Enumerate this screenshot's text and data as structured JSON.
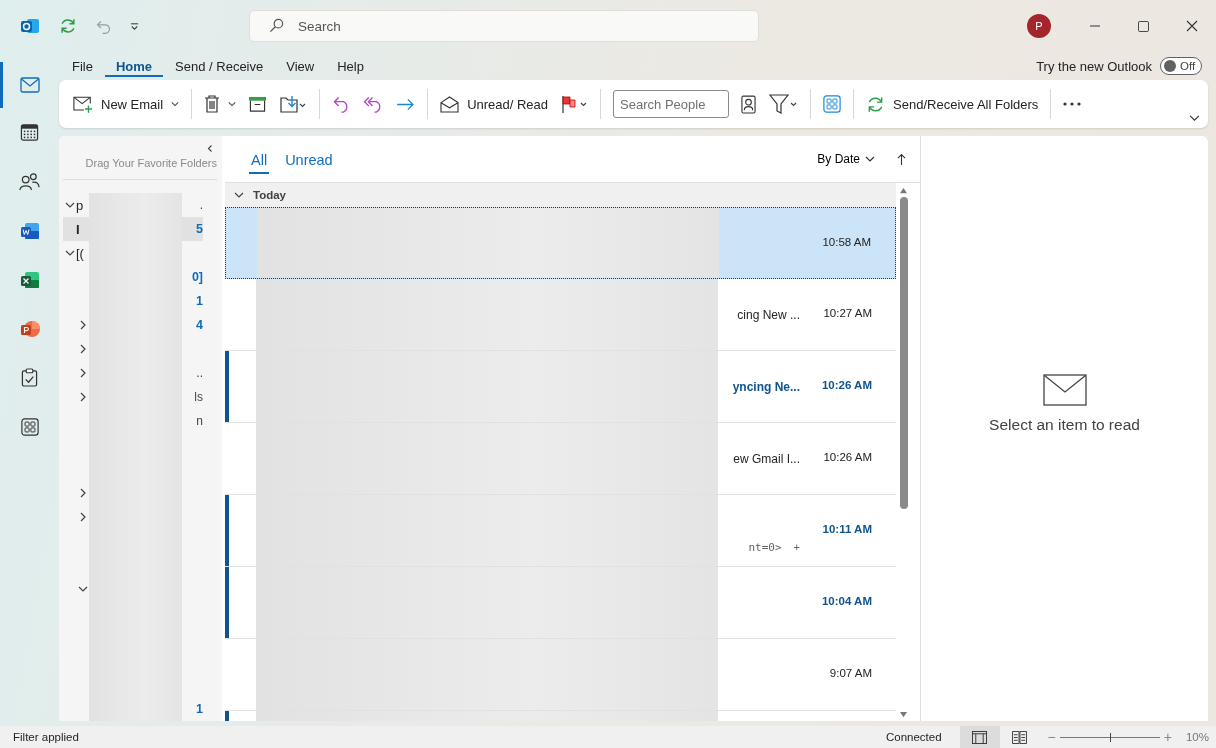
{
  "title_bar": {
    "search_placeholder": "Search",
    "account_initial": "P"
  },
  "menu_tabs": [
    {
      "label": "File",
      "selected": false
    },
    {
      "label": "Home",
      "selected": true
    },
    {
      "label": "Send / Receive",
      "selected": false
    },
    {
      "label": "View",
      "selected": false
    },
    {
      "label": "Help",
      "selected": false
    }
  ],
  "new_outlook": {
    "label": "Try the new Outlook",
    "on": false,
    "state_text": "Off"
  },
  "toolbar": {
    "new_email": "New Email",
    "unread_read": "Unread/ Read",
    "search_people_placeholder": "Search People",
    "send_receive": "Send/Receive All Folders"
  },
  "nav_rail": [
    {
      "kind": "mail",
      "selected": true
    },
    {
      "kind": "calendar",
      "selected": false
    },
    {
      "kind": "people",
      "selected": false
    },
    {
      "kind": "word",
      "selected": false
    },
    {
      "kind": "excel",
      "selected": false
    },
    {
      "kind": "powerpoint",
      "selected": false
    },
    {
      "kind": "tasks",
      "selected": false
    },
    {
      "kind": "apps",
      "selected": false
    }
  ],
  "folder_pane": {
    "hint": "Drag Your Favorite Folders",
    "folders": [
      {
        "expanded": true,
        "lead": "p",
        "tail": ".",
        "selected": false,
        "children": [
          {
            "lead": "I",
            "count": "5",
            "selected": true
          }
        ]
      },
      {
        "expanded": true,
        "lead": "[(",
        "selected": false,
        "children": [
          {
            "count": "0]",
            "selected": false
          },
          {
            "count": "1",
            "selected": false
          },
          {
            "expanded": false,
            "count": "4",
            "selected": false
          },
          {
            "expanded": false,
            "selected": false
          },
          {
            "expanded": false,
            "tail": "..",
            "selected": false
          },
          {
            "expanded": false,
            "tail": "ls",
            "selected": false
          },
          {
            "tail": "n",
            "selected": false
          },
          {
            "selected": false
          },
          {
            "selected": false
          },
          {
            "expanded": false,
            "selected": false
          },
          {
            "expanded": false,
            "selected": false
          },
          {
            "selected": false
          },
          {
            "selected": false
          },
          {
            "expanded": true,
            "selected": false,
            "children": [
              {
                "selected": false
              },
              {
                "selected": false
              },
              {
                "selected": false
              },
              {
                "selected": false
              },
              {
                "count": "1",
                "selected": false
              }
            ]
          }
        ]
      }
    ]
  },
  "message_list": {
    "filter_tabs": [
      {
        "label": "All",
        "selected": true
      },
      {
        "label": "Unread",
        "selected": false
      }
    ],
    "sort_label": "By Date",
    "group": {
      "label": "Today",
      "expanded": true
    },
    "messages": [
      {
        "selected": true,
        "unread": false,
        "time": "10:58 AM"
      },
      {
        "selected": false,
        "unread": false,
        "subject_tail": "cing New ...",
        "time": "10:27 AM"
      },
      {
        "selected": false,
        "unread": true,
        "subject_tail": "yncing Ne...",
        "time": "10:26 AM"
      },
      {
        "selected": false,
        "unread": false,
        "subject_tail": "ew Gmail I...",
        "time": "10:26 AM"
      },
      {
        "selected": false,
        "unread": true,
        "preview_tail": "nt=0>",
        "preview_mark": "+",
        "time": "10:11 AM"
      },
      {
        "selected": false,
        "unread": true,
        "time": "10:04 AM"
      },
      {
        "selected": false,
        "unread": false,
        "time": "9:07 AM"
      },
      {
        "selected": false,
        "unread": true
      }
    ]
  },
  "reading_pane": {
    "empty_text": "Select an item to read"
  },
  "status_bar": {
    "left": "Filter applied",
    "connection": "Connected",
    "views": [
      {
        "kind": "normal",
        "selected": true
      },
      {
        "kind": "reading",
        "selected": false
      }
    ],
    "zoom_out": "−",
    "zoom_in": "+",
    "zoom": {
      "level": 0.5
    },
    "zoom_text": "10%"
  }
}
